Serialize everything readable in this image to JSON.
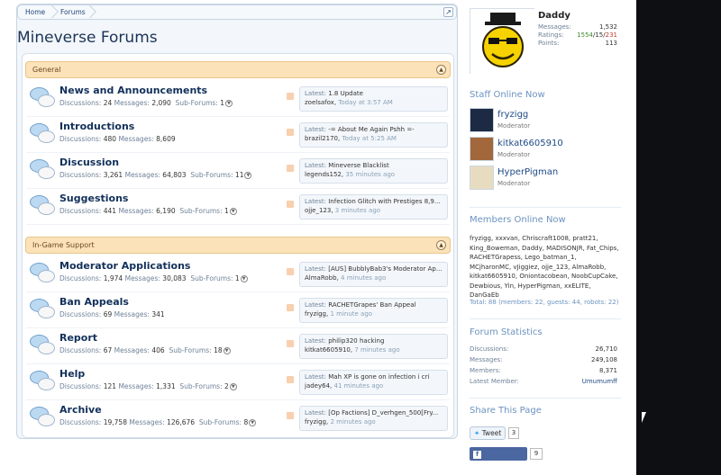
{
  "breadcrumb": {
    "items": [
      "Home",
      "Forums"
    ]
  },
  "page_title": "Mineverse Forums",
  "categories": [
    {
      "title": "General",
      "nodes": [
        {
          "title": "News and Announcements",
          "discussions_label": "Discussions:",
          "discussions": "24",
          "messages_label": "Messages:",
          "messages": "2,090",
          "subforums_label": "Sub-Forums:",
          "subforums": "1",
          "latest_prefix": "Latest:",
          "latest_title": "1.8 Update",
          "latest_user": "zoelsafox",
          "latest_time": "Today at 3:57 AM"
        },
        {
          "title": "Introductions",
          "discussions_label": "Discussions:",
          "discussions": "480",
          "messages_label": "Messages:",
          "messages": "8,609",
          "subforums_label": "",
          "subforums": "",
          "latest_prefix": "Latest:",
          "latest_title": "-= About Me Again Pshh =-",
          "latest_user": "brazil2170",
          "latest_time": "Today at 5:25 AM"
        },
        {
          "title": "Discussion",
          "discussions_label": "Discussions:",
          "discussions": "3,261",
          "messages_label": "Messages:",
          "messages": "64,803",
          "subforums_label": "Sub-Forums:",
          "subforums": "11",
          "latest_prefix": "Latest:",
          "latest_title": "Mineverse Blacklist",
          "latest_user": "legends152",
          "latest_time": "35 minutes ago"
        },
        {
          "title": "Suggestions",
          "discussions_label": "Discussions:",
          "discussions": "441",
          "messages_label": "Messages:",
          "messages": "6,190",
          "subforums_label": "Sub-Forums:",
          "subforums": "1",
          "latest_prefix": "Latest:",
          "latest_title": "Infection Glitch with Prestiges 8,9...",
          "latest_user": "ojje_123",
          "latest_time": "3 minutes ago"
        }
      ]
    },
    {
      "title": "In-Game Support",
      "nodes": [
        {
          "title": "Moderator Applications",
          "discussions_label": "Discussions:",
          "discussions": "1,974",
          "messages_label": "Messages:",
          "messages": "30,083",
          "subforums_label": "Sub-Forums:",
          "subforums": "1",
          "latest_prefix": "Latest:",
          "latest_title": "[AUS] BubblyBab3's Moderator Ap...",
          "latest_user": "AlmaRobb",
          "latest_time": "4 minutes ago"
        },
        {
          "title": "Ban Appeals",
          "discussions_label": "Discussions:",
          "discussions": "69",
          "messages_label": "Messages:",
          "messages": "341",
          "subforums_label": "",
          "subforums": "",
          "latest_prefix": "Latest:",
          "latest_title": "RACHETGrapes' Ban Appeal",
          "latest_user": "fryzigg",
          "latest_time": "1 minute ago"
        },
        {
          "title": "Report",
          "discussions_label": "Discussions:",
          "discussions": "67",
          "messages_label": "Messages:",
          "messages": "406",
          "subforums_label": "Sub-Forums:",
          "subforums": "18",
          "latest_prefix": "Latest:",
          "latest_title": "philip320 hacking",
          "latest_user": "kitkat6605910",
          "latest_time": "7 minutes ago"
        },
        {
          "title": "Help",
          "discussions_label": "Discussions:",
          "discussions": "121",
          "messages_label": "Messages:",
          "messages": "1,331",
          "subforums_label": "Sub-Forums:",
          "subforums": "2",
          "latest_prefix": "Latest:",
          "latest_title": "Mah XP is gone on infection i cri",
          "latest_user": "jadey64",
          "latest_time": "41 minutes ago"
        },
        {
          "title": "Archive",
          "discussions_label": "Discussions:",
          "discussions": "19,758",
          "messages_label": "Messages:",
          "messages": "126,676",
          "subforums_label": "Sub-Forums:",
          "subforums": "8",
          "latest_prefix": "Latest:",
          "latest_title": "[Op Factions] D_verhgen_500[Fry...",
          "latest_user": "fryzigg",
          "latest_time": "2 minutes ago"
        }
      ]
    }
  ],
  "visitor": {
    "name": "Daddy",
    "messages_label": "Messages:",
    "messages": "1,532",
    "ratings_label": "Ratings:",
    "ratings_pos": "1554",
    "ratings_neu": "15",
    "ratings_neg": "231",
    "points_label": "Points:",
    "points": "113"
  },
  "staff_online": {
    "title": "Staff Online Now",
    "members": [
      {
        "name": "fryzigg",
        "role": "Moderator"
      },
      {
        "name": "kitkat6605910",
        "role": "Moderator"
      },
      {
        "name": "HyperPigman",
        "role": "Moderator"
      }
    ]
  },
  "members_online": {
    "title": "Members Online Now",
    "list": "fryzigg, xxxvan, Chriscraft1008, pratt21, King_Boweman, Daddy, MADISONJR, Fat_Chips, RACHETGrapess, Lego_batman_1, MCjharonMC, vJiggiez, ojje_123, AlmaRobb, kitkat6605910, Oniontacobean, NoobCupCake, Dewbious, Yin, HyperPigman, xxELITE, DanGaEb",
    "total": "Total: 88 (members: 22, guests: 44, robots: 22)"
  },
  "forum_stats": {
    "title": "Forum Statistics",
    "rows": [
      {
        "label": "Discussions:",
        "value": "26,710"
      },
      {
        "label": "Messages:",
        "value": "249,108"
      },
      {
        "label": "Members:",
        "value": "8,371"
      },
      {
        "label": "Latest Member:",
        "value": "Umumumff"
      }
    ]
  },
  "share": {
    "title": "Share This Page",
    "tweet_label": "Tweet",
    "tweet_count": "3",
    "recommend_label": "Recommend",
    "recommend_count": "9"
  },
  "colors": {
    "accent": "#6b93c0",
    "category_bg": "#fbe2b8",
    "title_blue": "#12305a",
    "rating_pos": "#3b8a2c",
    "rating_neg": "#c0392b"
  }
}
